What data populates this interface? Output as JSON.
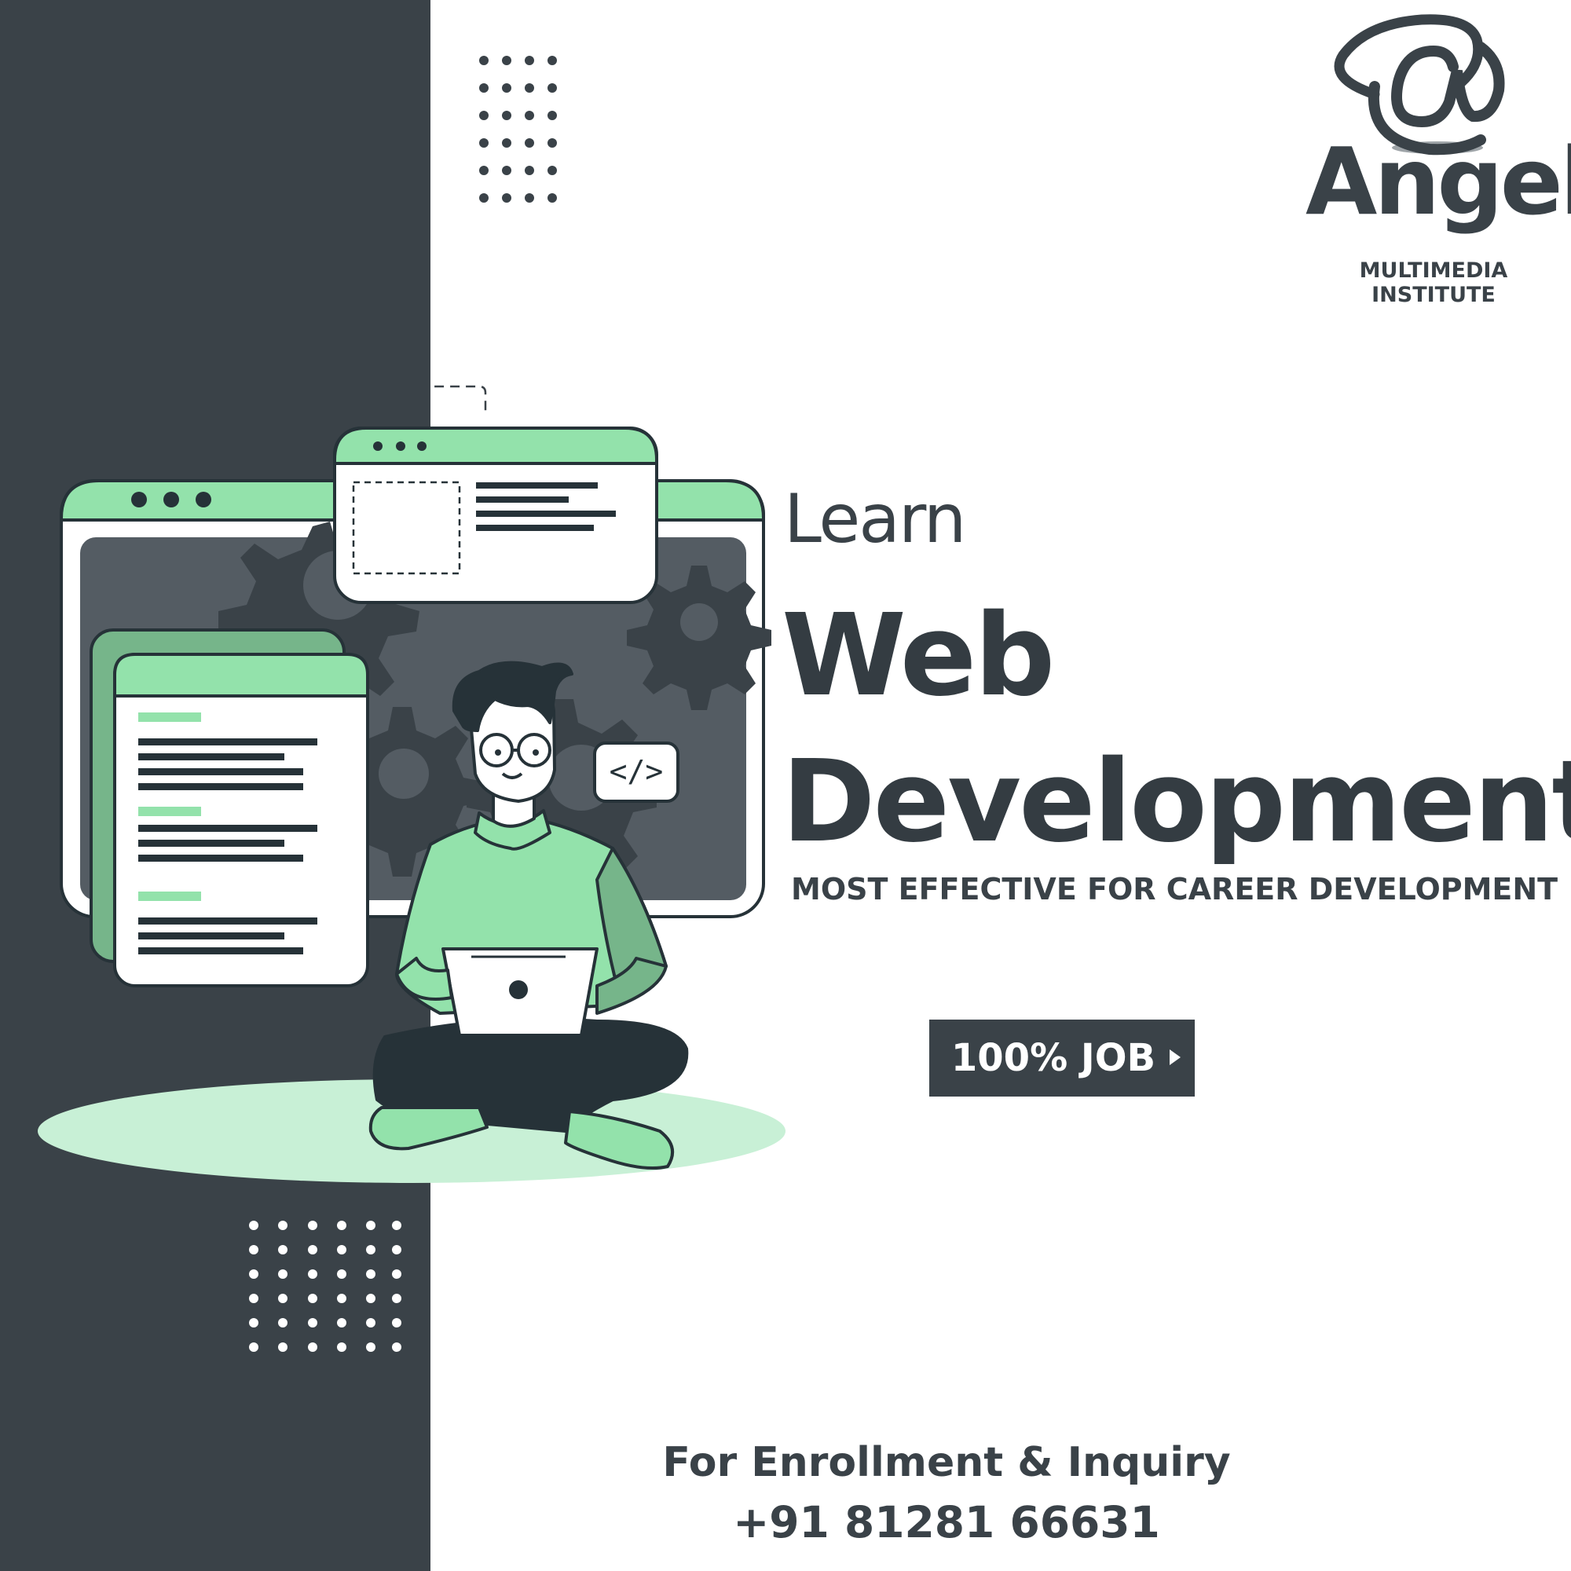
{
  "brand": {
    "logo_icon": "at-sign-icon",
    "name": "Angel",
    "subtitle": "MULTIMEDIA INSTITUTE"
  },
  "headline": {
    "learn": "Learn",
    "line1": "Web",
    "line2": "Development",
    "tagline": "MOST EFFECTIVE FOR CAREER DEVELOPMENT"
  },
  "cta": {
    "label": "100% JOB",
    "icon": "play-triangle-icon"
  },
  "contact": {
    "heading": "For Enrollment & Inquiry",
    "phone": "+91 81281 66631"
  },
  "illustration": {
    "code_badge": "</>"
  },
  "colors": {
    "dark": "#3a4248",
    "green": "#93e2ab",
    "green_dark": "#76b58a",
    "white": "#ffffff"
  }
}
